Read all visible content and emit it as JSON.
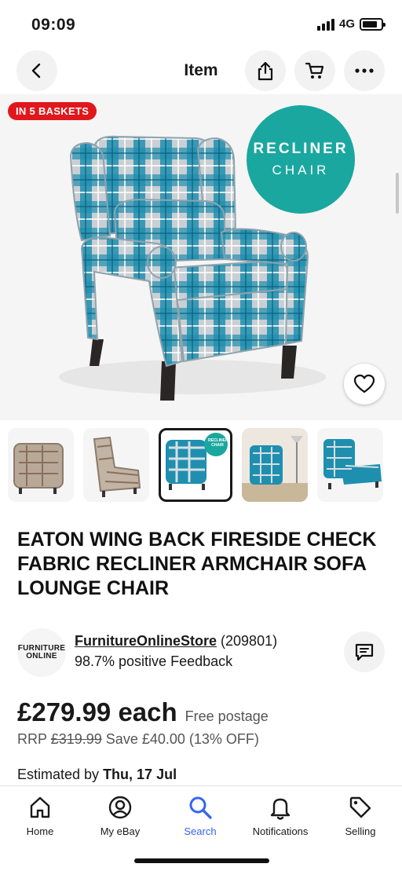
{
  "status_bar": {
    "time": "09:09",
    "network": "4G"
  },
  "header": {
    "title": "Item"
  },
  "hero": {
    "badge": "IN 5 BASKETS",
    "overlay_line1": "RECLINER",
    "overlay_line2": "CHAIR"
  },
  "thumbnails": {
    "count": 5,
    "selected_index": 2,
    "selected_overlay": "RECLINER CHAIR"
  },
  "item": {
    "title": "EATON WING BACK FIRESIDE CHECK FABRIC RECLINER ARMCHAIR SOFA LOUNGE CHAIR"
  },
  "seller": {
    "logo_line1": "FURNITURE",
    "logo_line2": "ONLINE",
    "name": "FurnitureOnlineStore",
    "rating_count": "(209801)",
    "feedback": "98.7% positive Feedback"
  },
  "price": {
    "amount": "£279.99 each",
    "postage": "Free postage",
    "rrp_label": "RRP",
    "rrp_value": "£319.99",
    "saving": "Save £40.00 (13% OFF)",
    "estimate_label": "Estimated by",
    "estimate_date": "Thu, 17 Jul"
  },
  "nav": {
    "home": "Home",
    "my_ebay": "My eBay",
    "search": "Search",
    "notifications": "Notifications",
    "selling": "Selling"
  },
  "colors": {
    "accent": "#3665f3",
    "badge_red": "#e0181d",
    "teal": "#1aa79f",
    "plaid_blue": "#1f8fb0"
  },
  "icons": [
    "back-icon",
    "share-icon",
    "cart-icon",
    "more-icon",
    "heart-icon",
    "message-icon",
    "home-icon",
    "user-icon",
    "search-icon",
    "bell-icon",
    "tag-icon"
  ]
}
